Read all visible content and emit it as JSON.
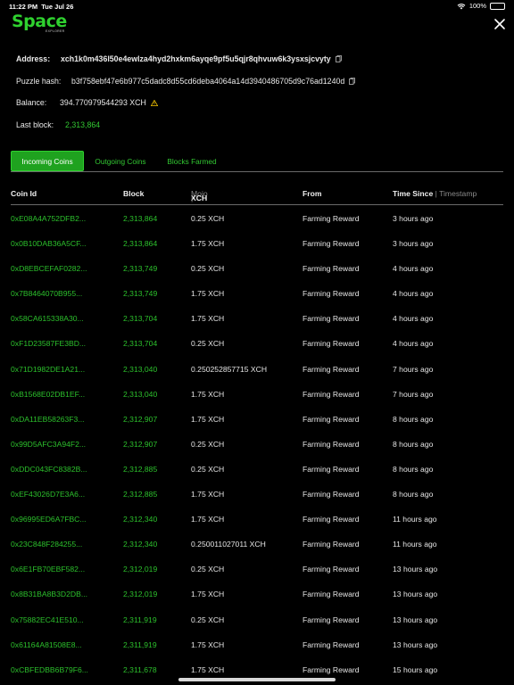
{
  "status_bar": {
    "time": "11:22 PM",
    "date": "Tue Jul 26",
    "battery": "100%"
  },
  "logo": {
    "word": "Space",
    "sub": "EXPLORER"
  },
  "info": {
    "address_label": "Address:",
    "address_value": "xch1k0m436l50e4ewlza4hyd2hxkm6ayqe9pf5u5qjr8qhvuw6k3ysxsjcvyty",
    "puzzle_label": "Puzzle hash:",
    "puzzle_value": "b3f758ebf47e6b977c5dadc8d55cd6deba4064a14d3940486705d9c76ad1240d",
    "balance_label": "Balance:",
    "balance_value": "394.770979544293 XCH",
    "last_block_label": "Last block:",
    "last_block_value": "2,313,864"
  },
  "tabs": [
    "Incoming Coins",
    "Outgoing Coins",
    "Blocks Farmed"
  ],
  "table": {
    "headers": {
      "coin_id": "Coin Id",
      "block": "Block",
      "xch": "XCH",
      "sep1": " | ",
      "mojo": "Mojo",
      "from": "From",
      "time_since": "Time Since",
      "sep2": " | ",
      "timestamp": "Timestamp"
    },
    "rows": [
      {
        "coin": "0xE08A4A752DFB2...",
        "block": "2,313,864",
        "amount": "0.25 XCH",
        "from": "Farming Reward",
        "time": "3 hours ago"
      },
      {
        "coin": "0x0B10DAB36A5CF...",
        "block": "2,313,864",
        "amount": "1.75 XCH",
        "from": "Farming Reward",
        "time": "3 hours ago"
      },
      {
        "coin": "0xD8EBCEFAF0282...",
        "block": "2,313,749",
        "amount": "0.25 XCH",
        "from": "Farming Reward",
        "time": "4 hours ago"
      },
      {
        "coin": "0x7B8464070B955...",
        "block": "2,313,749",
        "amount": "1.75 XCH",
        "from": "Farming Reward",
        "time": "4 hours ago"
      },
      {
        "coin": "0x58CA615338A30...",
        "block": "2,313,704",
        "amount": "1.75 XCH",
        "from": "Farming Reward",
        "time": "4 hours ago"
      },
      {
        "coin": "0xF1D23587FE3BD...",
        "block": "2,313,704",
        "amount": "0.25 XCH",
        "from": "Farming Reward",
        "time": "4 hours ago"
      },
      {
        "coin": "0x71D1982DE1A21...",
        "block": "2,313,040",
        "amount": "0.250252857715 XCH",
        "from": "Farming Reward",
        "time": "7 hours ago"
      },
      {
        "coin": "0xB1568E02DB1EF...",
        "block": "2,313,040",
        "amount": "1.75 XCH",
        "from": "Farming Reward",
        "time": "7 hours ago"
      },
      {
        "coin": "0xDA11EB58263F3...",
        "block": "2,312,907",
        "amount": "1.75 XCH",
        "from": "Farming Reward",
        "time": "8 hours ago"
      },
      {
        "coin": "0x99D5AFC3A94F2...",
        "block": "2,312,907",
        "amount": "0.25 XCH",
        "from": "Farming Reward",
        "time": "8 hours ago"
      },
      {
        "coin": "0xDDC043FC8382B...",
        "block": "2,312,885",
        "amount": "0.25 XCH",
        "from": "Farming Reward",
        "time": "8 hours ago"
      },
      {
        "coin": "0xEF43026D7E3A6...",
        "block": "2,312,885",
        "amount": "1.75 XCH",
        "from": "Farming Reward",
        "time": "8 hours ago"
      },
      {
        "coin": "0x96995ED6A7FBC...",
        "block": "2,312,340",
        "amount": "1.75 XCH",
        "from": "Farming Reward",
        "time": "11 hours ago"
      },
      {
        "coin": "0x23C848F284255...",
        "block": "2,312,340",
        "amount": "0.250011027011 XCH",
        "from": "Farming Reward",
        "time": "11 hours ago"
      },
      {
        "coin": "0x6E1FB70EBF582...",
        "block": "2,312,019",
        "amount": "0.25 XCH",
        "from": "Farming Reward",
        "time": "13 hours ago"
      },
      {
        "coin": "0x8B31BA8B3D2DB...",
        "block": "2,312,019",
        "amount": "1.75 XCH",
        "from": "Farming Reward",
        "time": "13 hours ago"
      },
      {
        "coin": "0x75882EC41E510...",
        "block": "2,311,919",
        "amount": "0.25 XCH",
        "from": "Farming Reward",
        "time": "13 hours ago"
      },
      {
        "coin": "0x61164A81508E8...",
        "block": "2,311,919",
        "amount": "1.75 XCH",
        "from": "Farming Reward",
        "time": "13 hours ago"
      },
      {
        "coin": "0xCBFEDBB6B79F6...",
        "block": "2,311,678",
        "amount": "1.75 XCH",
        "from": "Farming Reward",
        "time": "15 hours ago"
      }
    ]
  },
  "colors": {
    "accent": "#2fd12f",
    "link_green": "#2cc02c",
    "warning": "#f2c200",
    "background": "#000000"
  },
  "icons": {
    "wifi": "wifi-icon",
    "battery": "battery-icon",
    "close": "close-icon",
    "copy": "copy-icon",
    "warning": "warning-icon"
  }
}
